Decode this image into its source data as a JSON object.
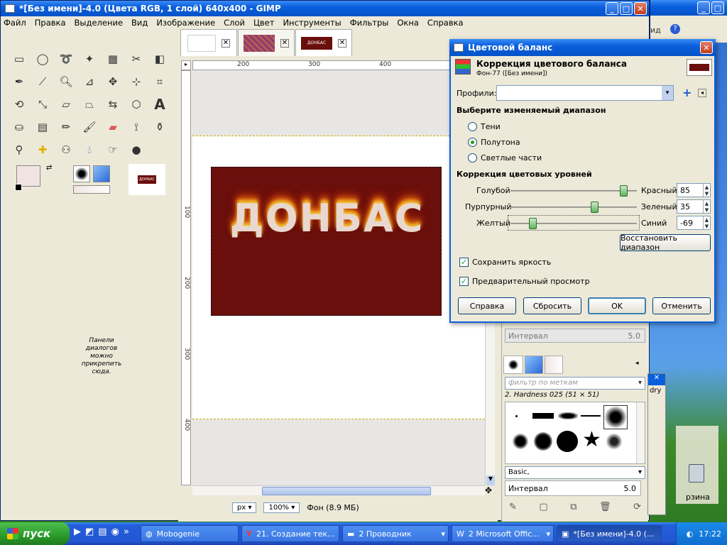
{
  "window": {
    "title": "*[Без имени]-4.0 (Цвета RGB, 1 слой) 640x400 - GIMP",
    "menu": [
      "Файл",
      "Правка",
      "Выделение",
      "Вид",
      "Изображение",
      "Слой",
      "Цвет",
      "Инструменты",
      "Фильтры",
      "Окна",
      "Справка"
    ]
  },
  "toolbox": {
    "dock_hint": "Панели диалогов можно прикрепить сюда."
  },
  "image_window": {
    "ruler_marks": [
      "200",
      "300",
      "400"
    ],
    "vruler_marks": [
      "100",
      "200",
      "300",
      "400"
    ],
    "unit": "px",
    "zoom": "100%",
    "status": "Фон (8.9 МБ)",
    "logo_text": "ДОНБАС",
    "thumb_text": "ДОНБАС"
  },
  "dialog": {
    "title": "Цветовой баланс",
    "header": "Коррекция цветового баланса",
    "subheader": "Фон-77 ([Без имени])",
    "profiles_label": "Профили:",
    "range_title": "Выберите изменяемый диапазон",
    "ranges": [
      "Тени",
      "Полутона",
      "Светлые части"
    ],
    "selected_range": "Полутона",
    "levels_title": "Коррекция цветовых уровней",
    "sliders": [
      {
        "left": "Голубой",
        "right": "Красный",
        "value": "85",
        "level": 85
      },
      {
        "left": "Пурпурный",
        "right": "Зеленый",
        "value": "35",
        "level": 35
      },
      {
        "left": "Желтый",
        "right": "Синий",
        "value": "-69",
        "level": -69
      }
    ],
    "reset_range": "Восстановить диапазон",
    "preserve": "Сохранить яркость",
    "preview": "Предварительный просмотр",
    "buttons": {
      "help": "Справка",
      "reset": "Сбросить",
      "ok": "OK",
      "cancel": "Отменить"
    }
  },
  "dock": {
    "interval_label": "Интервал",
    "interval_value": "5.0",
    "filter_placeholder": "фильтр по меткам",
    "brush_name": "2. Hardness 025 (51 × 51)",
    "brush_set": "Basic,",
    "interval_label2": "Интервал",
    "interval_value2": "5.0"
  },
  "taskbar": {
    "start": "пуск",
    "tasks": [
      "Mobogenie",
      "21. Создание тек...",
      "2 Проводник",
      "2 Microsoft Offic...",
      "*[Без имени]-4.0 (..."
    ],
    "time": "17:22"
  },
  "desktop": {
    "right_label": "ид",
    "recycle": "рзина",
    "side_label": "dry"
  }
}
